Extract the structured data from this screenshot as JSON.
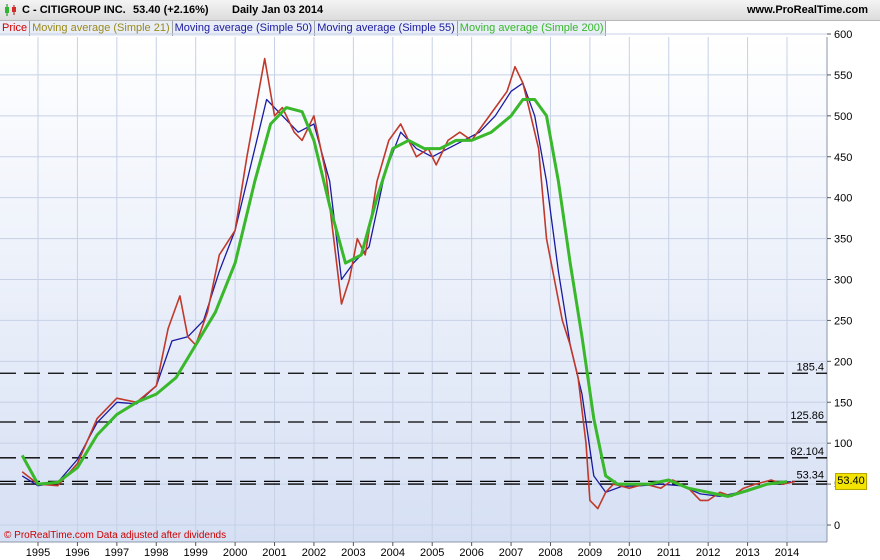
{
  "header": {
    "title": "C - CITIGROUP INC.",
    "price_change": "53.40 (+2.16%)",
    "period_date": "Daily  Jan 03 2014",
    "site": "www.ProRealTime.com"
  },
  "legend": [
    {
      "label": "Price",
      "color": "#d40000"
    },
    {
      "label": "Moving average (Simple 21)",
      "color": "#9a8a1a"
    },
    {
      "label": "Moving average (Simple 50)",
      "color": "#1a1aa0"
    },
    {
      "label": "Moving average (Simple 55)",
      "color": "#1a1aa0"
    },
    {
      "label": "Moving average (Simple 200)",
      "color": "#38b82a"
    }
  ],
  "footer": "© ProRealTime.com  Data adjusted after dividends",
  "price_tag": "53.40",
  "chart_data": {
    "type": "line",
    "ylim": [
      -10,
      610
    ],
    "xlim": [
      1994.6,
      2014.9
    ],
    "y_ticks": [
      0,
      50,
      100,
      150,
      200,
      250,
      300,
      350,
      400,
      450,
      500,
      550,
      600
    ],
    "x_ticks": [
      "1995",
      "1996",
      "1997",
      "1998",
      "1999",
      "2000",
      "2001",
      "2002",
      "2003",
      "2004",
      "2005",
      "2006",
      "2007",
      "2008",
      "2009",
      "2010",
      "2011",
      "2012",
      "2013",
      "2014"
    ],
    "hlines": [
      {
        "value": 185.4,
        "label": "185.4"
      },
      {
        "value": 125.86,
        "label": "125.86"
      },
      {
        "value": 82.104,
        "label": "82.104"
      },
      {
        "value": 53.34,
        "label": "53.34"
      },
      {
        "value": 50,
        "label": "50"
      }
    ],
    "series": [
      {
        "name": "Price",
        "color": "#c0392b",
        "x": [
          1994.6,
          1995.0,
          1995.5,
          1996.0,
          1996.5,
          1997.0,
          1997.5,
          1998.0,
          1998.3,
          1998.6,
          1998.8,
          1999.0,
          1999.3,
          1999.6,
          2000.0,
          2000.3,
          2000.6,
          2000.75,
          2001.0,
          2001.2,
          2001.5,
          2001.7,
          2002.0,
          2002.3,
          2002.5,
          2002.7,
          2002.9,
          2003.1,
          2003.3,
          2003.6,
          2003.9,
          2004.2,
          2004.6,
          2004.9,
          2005.1,
          2005.4,
          2005.7,
          2006.0,
          2006.3,
          2006.6,
          2006.9,
          2007.1,
          2007.3,
          2007.5,
          2007.7,
          2007.9,
          2008.1,
          2008.3,
          2008.5,
          2008.7,
          2008.9,
          2009.0,
          2009.2,
          2009.4,
          2009.6,
          2010.0,
          2010.4,
          2010.8,
          2011.1,
          2011.5,
          2011.8,
          2012.0,
          2012.3,
          2012.6,
          2012.9,
          2013.2,
          2013.6,
          2013.9,
          2014.2
        ],
        "values": [
          65,
          50,
          48,
          75,
          130,
          155,
          150,
          170,
          240,
          280,
          230,
          220,
          260,
          330,
          360,
          450,
          530,
          570,
          500,
          510,
          480,
          470,
          500,
          430,
          350,
          270,
          300,
          350,
          330,
          420,
          470,
          490,
          450,
          460,
          440,
          470,
          480,
          470,
          490,
          510,
          530,
          560,
          540,
          500,
          460,
          350,
          300,
          250,
          220,
          180,
          100,
          30,
          20,
          40,
          50,
          45,
          50,
          45,
          55,
          45,
          30,
          30,
          40,
          35,
          45,
          50,
          55,
          50,
          53
        ]
      },
      {
        "name": "Moving average (Simple 200)",
        "color": "#38b82a",
        "x": [
          1994.6,
          1995.0,
          1995.5,
          1996.0,
          1996.5,
          1997.0,
          1997.5,
          1998.0,
          1998.5,
          1999.0,
          1999.5,
          2000.0,
          2000.5,
          2000.9,
          2001.3,
          2001.7,
          2002.0,
          2002.4,
          2002.8,
          2003.2,
          2003.6,
          2004.0,
          2004.4,
          2004.8,
          2005.2,
          2005.6,
          2006.0,
          2006.5,
          2007.0,
          2007.3,
          2007.6,
          2007.9,
          2008.2,
          2008.5,
          2008.8,
          2009.1,
          2009.4,
          2009.7,
          2010.0,
          2010.5,
          2011.0,
          2011.5,
          2012.0,
          2012.5,
          2013.0,
          2013.5,
          2014.0
        ],
        "values": [
          85,
          50,
          52,
          70,
          110,
          135,
          150,
          160,
          180,
          220,
          260,
          320,
          420,
          490,
          510,
          505,
          470,
          390,
          320,
          330,
          400,
          460,
          470,
          460,
          460,
          470,
          470,
          480,
          500,
          520,
          520,
          500,
          420,
          320,
          230,
          130,
          60,
          50,
          50,
          50,
          55,
          45,
          40,
          35,
          42,
          50,
          53
        ]
      },
      {
        "name": "Moving average (Simple 55)",
        "color": "#1a1aa0",
        "x": [
          1994.6,
          1995.0,
          1995.5,
          1996.0,
          1996.5,
          1997.0,
          1997.5,
          1998.0,
          1998.4,
          1998.8,
          1999.2,
          1999.6,
          2000.0,
          2000.4,
          2000.8,
          2001.2,
          2001.6,
          2002.0,
          2002.4,
          2002.7,
          2003.0,
          2003.4,
          2003.8,
          2004.2,
          2004.6,
          2005.0,
          2005.4,
          2005.8,
          2006.2,
          2006.6,
          2007.0,
          2007.3,
          2007.6,
          2007.9,
          2008.2,
          2008.5,
          2008.8,
          2009.1,
          2009.4,
          2009.8,
          2010.3,
          2010.8,
          2011.3,
          2011.8,
          2012.3,
          2012.8,
          2013.3,
          2013.8,
          2014.1
        ],
        "values": [
          60,
          48,
          52,
          80,
          125,
          150,
          148,
          170,
          225,
          230,
          250,
          310,
          360,
          440,
          520,
          500,
          480,
          490,
          420,
          300,
          320,
          340,
          430,
          480,
          460,
          450,
          460,
          470,
          480,
          500,
          530,
          540,
          500,
          420,
          310,
          220,
          160,
          60,
          40,
          47,
          48,
          50,
          48,
          38,
          35,
          40,
          48,
          52,
          53
        ]
      }
    ]
  }
}
